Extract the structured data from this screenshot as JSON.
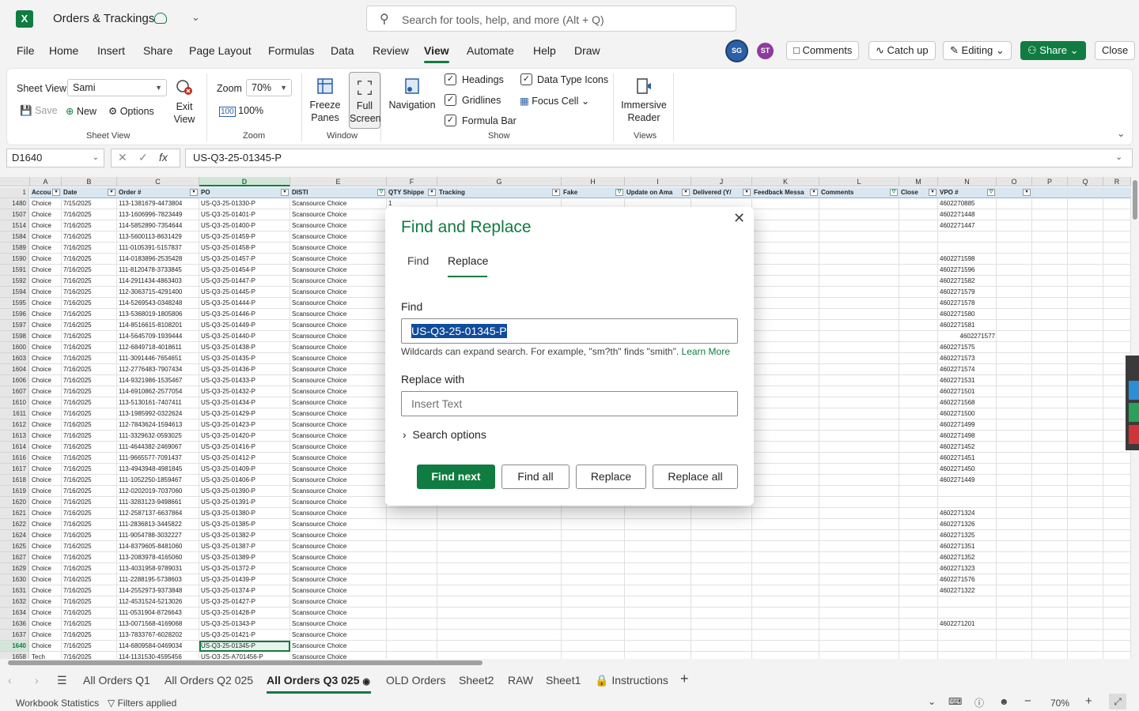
{
  "app": {
    "title": "Orders & Trackings",
    "search_placeholder": "Search for tools, help, and more (Alt + Q)",
    "logo_letter": "X"
  },
  "menu": [
    "File",
    "Home",
    "Insert",
    "Share",
    "Page Layout",
    "Formulas",
    "Data",
    "Review",
    "View",
    "Automate",
    "Help",
    "Draw"
  ],
  "active_menu": "View",
  "avatars": [
    {
      "initials": "SG",
      "color": "#2b5fa7"
    },
    {
      "initials": "ST",
      "color": "#8e3b9e"
    }
  ],
  "top_buttons": {
    "comments": "Comments",
    "catch_up": "Catch up",
    "editing": "Editing",
    "share": "Share",
    "close": "Close"
  },
  "ribbon": {
    "sheet_view_label": "Sheet View",
    "sheet_view_value": "Sami",
    "save": "Save",
    "new": "New",
    "options": "Options",
    "exit_view": "Exit View",
    "group_sheet_view": "Sheet View",
    "zoom_label": "Zoom",
    "zoom_value": "70%",
    "zoom_100": "100%",
    "group_zoom": "Zoom",
    "freeze_panes": "Freeze Panes",
    "full_screen": "Full Screen",
    "group_window": "Window",
    "navigation": "Navigation",
    "headings": "Headings",
    "gridlines": "Gridlines",
    "formula_bar": "Formula Bar",
    "data_type_icons": "Data Type Icons",
    "focus_cell": "Focus Cell",
    "group_show": "Show",
    "immersive_reader": "Immersive Reader",
    "group_views": "Views"
  },
  "formula_bar": {
    "name_box": "D1640",
    "formula": "US-Q3-25-01345-P"
  },
  "columns": [
    "A",
    "B",
    "C",
    "D",
    "E",
    "F",
    "G",
    "H",
    "I",
    "J",
    "K",
    "L",
    "M",
    "N",
    "O",
    "P",
    "Q",
    "R"
  ],
  "header_row": {
    "row_num": "1",
    "cells": [
      "Accou",
      "Date",
      "Order #",
      "PO",
      "DISTI",
      "QTY Shippe",
      "Tracking",
      "Fake",
      "Update on Ama",
      "Delivered (Y/",
      "Feedback Messa",
      "Comments",
      "Close",
      "VPO #",
      "",
      "",
      "",
      ""
    ]
  },
  "rows": [
    {
      "n": "1480",
      "a": "Choice",
      "b": "7/15/2025",
      "c": "113-1381679-4473804",
      "d": "US-Q3-25-01330-P",
      "e": "Scansource Choice",
      "f": "1",
      "vpo": "4602270885"
    },
    {
      "n": "1507",
      "a": "Choice",
      "b": "7/16/2025",
      "c": "113-1606996-7823449",
      "d": "US-Q3-25-01401-P",
      "e": "Scansource Choice",
      "f": "",
      "vpo": "4602271448"
    },
    {
      "n": "1514",
      "a": "Choice",
      "b": "7/16/2025",
      "c": "114-5852890-7354644",
      "d": "US-Q3-25-01400-P",
      "e": "Scansource Choice",
      "f": "",
      "vpo": "4602271447"
    },
    {
      "n": "1584",
      "a": "Choice",
      "b": "7/16/2025",
      "c": "113-5600113-8631429",
      "d": "US-Q3-25-01459-P",
      "e": "Scansource Choice",
      "f": "",
      "vpo": ""
    },
    {
      "n": "1589",
      "a": "Choice",
      "b": "7/16/2025",
      "c": "111-0105391-5157837",
      "d": "US-Q3-25-01458-P",
      "e": "Scansource Choice",
      "f": "",
      "vpo": ""
    },
    {
      "n": "1590",
      "a": "Choice",
      "b": "7/16/2025",
      "c": "114-0183896-2535428",
      "d": "US-Q3-25-01457-P",
      "e": "Scansource Choice",
      "f": "",
      "vpo": "4602271598"
    },
    {
      "n": "1591",
      "a": "Choice",
      "b": "7/16/2025",
      "c": "111-8120478-3733845",
      "d": "US-Q3-25-01454-P",
      "e": "Scansource Choice",
      "f": "",
      "vpo": "4602271596"
    },
    {
      "n": "1592",
      "a": "Choice",
      "b": "7/16/2025",
      "c": "114-2911434-4863403",
      "d": "US-Q3-25-01447-P",
      "e": "Scansource Choice",
      "f": "",
      "vpo": "4602271582"
    },
    {
      "n": "1594",
      "a": "Choice",
      "b": "7/16/2025",
      "c": "112-3063715-4291400",
      "d": "US-Q3-25-01445-P",
      "e": "Scansource Choice",
      "f": "",
      "vpo": "4602271579"
    },
    {
      "n": "1595",
      "a": "Choice",
      "b": "7/16/2025",
      "c": "114-5269543-0348248",
      "d": "US-Q3-25-01444-P",
      "e": "Scansource Choice",
      "f": "",
      "vpo": "4602271578"
    },
    {
      "n": "1596",
      "a": "Choice",
      "b": "7/16/2025",
      "c": "113-5368019-1805806",
      "d": "US-Q3-25-01446-P",
      "e": "Scansource Choice",
      "f": "",
      "vpo": "4602271580"
    },
    {
      "n": "1597",
      "a": "Choice",
      "b": "7/16/2025",
      "c": "114-8516615-8108201",
      "d": "US-Q3-25-01449-P",
      "e": "Scansource Choice",
      "f": "",
      "vpo": "4602271581"
    },
    {
      "n": "1598",
      "a": "Choice",
      "b": "7/16/2025",
      "c": "114-5645709-1939444",
      "d": "US-Q3-25-01440-P",
      "e": "Scansource Choice",
      "f": "",
      "vpo": "4602271577",
      "vpo_right": true
    },
    {
      "n": "1600",
      "a": "Choice",
      "b": "7/16/2025",
      "c": "112-6849718-4018611",
      "d": "US-Q3-25-01438-P",
      "e": "Scansource Choice",
      "f": "",
      "vpo": "4602271575"
    },
    {
      "n": "1603",
      "a": "Choice",
      "b": "7/16/2025",
      "c": "111-3091446-7654651",
      "d": "US-Q3-25-01435-P",
      "e": "Scansource Choice",
      "f": "",
      "vpo": "4602271573"
    },
    {
      "n": "1604",
      "a": "Choice",
      "b": "7/16/2025",
      "c": "112-2776483-7907434",
      "d": "US-Q3-25-01436-P",
      "e": "Scansource Choice",
      "f": "",
      "vpo": "4602271574"
    },
    {
      "n": "1606",
      "a": "Choice",
      "b": "7/16/2025",
      "c": "114-9321986-1535467",
      "d": "US-Q3-25-01433-P",
      "e": "Scansource Choice",
      "f": "",
      "vpo": "4602271531"
    },
    {
      "n": "1607",
      "a": "Choice",
      "b": "7/16/2025",
      "c": "114-6910862-2577054",
      "d": "US-Q3-25-01432-P",
      "e": "Scansource Choice",
      "f": "",
      "vpo": "4602271501"
    },
    {
      "n": "1610",
      "a": "Choice",
      "b": "7/16/2025",
      "c": "113-5130161-7407411",
      "d": "US-Q3-25-01434-P",
      "e": "Scansource Choice",
      "f": "",
      "vpo": "4602271568"
    },
    {
      "n": "1611",
      "a": "Choice",
      "b": "7/16/2025",
      "c": "113-1985992-0322624",
      "d": "US-Q3-25-01429-P",
      "e": "Scansource Choice",
      "f": "",
      "vpo": "4602271500"
    },
    {
      "n": "1612",
      "a": "Choice",
      "b": "7/16/2025",
      "c": "112-7843624-1594613",
      "d": "US-Q3-25-01423-P",
      "e": "Scansource Choice",
      "f": "",
      "vpo": "4602271499"
    },
    {
      "n": "1613",
      "a": "Choice",
      "b": "7/16/2025",
      "c": "111-3329632-0593025",
      "d": "US-Q3-25-01420-P",
      "e": "Scansource Choice",
      "f": "",
      "vpo": "4602271498"
    },
    {
      "n": "1614",
      "a": "Choice",
      "b": "7/16/2025",
      "c": "111-4644382-2469067",
      "d": "US-Q3-25-01416-P",
      "e": "Scansource Choice",
      "f": "",
      "vpo": "4602271452"
    },
    {
      "n": "1616",
      "a": "Choice",
      "b": "7/16/2025",
      "c": "111-9665577-7091437",
      "d": "US-Q3-25-01412-P",
      "e": "Scansource Choice",
      "f": "",
      "vpo": "4602271451"
    },
    {
      "n": "1617",
      "a": "Choice",
      "b": "7/16/2025",
      "c": "113-4943948-4981845",
      "d": "US-Q3-25-01409-P",
      "e": "Scansource Choice",
      "f": "",
      "vpo": "4602271450"
    },
    {
      "n": "1618",
      "a": "Choice",
      "b": "7/16/2025",
      "c": "111-1052250-1859467",
      "d": "US-Q3-25-01406-P",
      "e": "Scansource Choice",
      "f": "",
      "vpo": "4602271449"
    },
    {
      "n": "1619",
      "a": "Choice",
      "b": "7/16/2025",
      "c": "112-0202019-7037060",
      "d": "US-Q3-25-01390-P",
      "e": "Scansource Choice",
      "f": "",
      "vpo": ""
    },
    {
      "n": "1620",
      "a": "Choice",
      "b": "7/16/2025",
      "c": "111-3283123-9498661",
      "d": "US-Q3-25-01391-P",
      "e": "Scansource Choice",
      "f": "",
      "vpo": ""
    },
    {
      "n": "1621",
      "a": "Choice",
      "b": "7/16/2025",
      "c": "112-2587137-6637864",
      "d": "US-Q3-25-01380-P",
      "e": "Scansource Choice",
      "f": "",
      "vpo": "4602271324"
    },
    {
      "n": "1622",
      "a": "Choice",
      "b": "7/16/2025",
      "c": "111-2836813-3445822",
      "d": "US-Q3-25-01385-P",
      "e": "Scansource Choice",
      "f": "",
      "vpo": "4602271326"
    },
    {
      "n": "1624",
      "a": "Choice",
      "b": "7/16/2025",
      "c": "111-9054788-3032227",
      "d": "US-Q3-25-01382-P",
      "e": "Scansource Choice",
      "f": "",
      "vpo": "4602271325"
    },
    {
      "n": "1625",
      "a": "Choice",
      "b": "7/16/2025",
      "c": "114-8379605-8481060",
      "d": "US-Q3-25-01387-P",
      "e": "Scansource Choice",
      "f": "",
      "vpo": "4602271351"
    },
    {
      "n": "1627",
      "a": "Choice",
      "b": "7/16/2025",
      "c": "113-2083978-4165060",
      "d": "US-Q3-25-01389-P",
      "e": "Scansource Choice",
      "f": "",
      "vpo": "4602271352"
    },
    {
      "n": "1629",
      "a": "Choice",
      "b": "7/16/2025",
      "c": "113-4031958-9789031",
      "d": "US-Q3-25-01372-P",
      "e": "Scansource Choice",
      "f": "",
      "vpo": "4602271323"
    },
    {
      "n": "1630",
      "a": "Choice",
      "b": "7/16/2025",
      "c": "111-2288195-5738603",
      "d": "US-Q3-25-01439-P",
      "e": "Scansource Choice",
      "f": "",
      "vpo": "4602271576"
    },
    {
      "n": "1631",
      "a": "Choice",
      "b": "7/16/2025",
      "c": "114-2552973-9373848",
      "d": "US-Q3-25-01374-P",
      "e": "Scansource Choice",
      "f": "",
      "vpo": "4602271322"
    },
    {
      "n": "1632",
      "a": "Choice",
      "b": "7/16/2025",
      "c": "112-4531524-5213026",
      "d": "US-Q3-25-01427-P",
      "e": "Scansource Choice",
      "f": "",
      "vpo": ""
    },
    {
      "n": "1634",
      "a": "Choice",
      "b": "7/16/2025",
      "c": "111-0531904-8726643",
      "d": "US-Q3-25-01428-P",
      "e": "Scansource Choice",
      "f": "",
      "vpo": ""
    },
    {
      "n": "1636",
      "a": "Choice",
      "b": "7/16/2025",
      "c": "113-0071568-4169068",
      "d": "US-Q3-25-01343-P",
      "e": "Scansource Choice",
      "f": "",
      "vpo": "4602271201"
    },
    {
      "n": "1637",
      "a": "Choice",
      "b": "7/16/2025",
      "c": "113-7833767-6028202",
      "d": "US-Q3-25-01421-P",
      "e": "Scansource Choice",
      "f": "",
      "vpo": ""
    },
    {
      "n": "1640",
      "a": "Choice",
      "b": "7/16/2025",
      "c": "114-6809584-0469034",
      "d": "US-Q3-25-01345-P",
      "e": "Scansource Choice",
      "f": "",
      "vpo": "",
      "active": true
    },
    {
      "n": "1658",
      "a": "Tech",
      "b": "7/16/2025",
      "c": "114-1131530-4595456",
      "d": "US-Q3-25-A701456-P",
      "e": "Scansource Choice",
      "f": "",
      "vpo": ""
    }
  ],
  "sheet_tabs": [
    "All Orders Q1",
    "All Orders Q2 025",
    "All Orders Q3 025",
    "OLD Orders",
    "Sheet2",
    "RAW",
    "Sheet1",
    "Instructions"
  ],
  "active_sheet": "All Orders Q3 025",
  "status": {
    "workbook_statistics": "Workbook Statistics",
    "filters_applied": "Filters applied",
    "zoom": "70%"
  },
  "dialog": {
    "title": "Find and Replace",
    "tab_find": "Find",
    "tab_replace": "Replace",
    "find_label": "Find",
    "find_value": "US-Q3-25-01345-P",
    "hint": "Wildcards can expand search. For example, \"sm?th\" finds \"smith\".",
    "learn_more": "Learn More",
    "replace_label": "Replace with",
    "replace_placeholder": "Insert Text",
    "search_options": "Search options",
    "find_next": "Find next",
    "find_all": "Find all",
    "replace": "Replace",
    "replace_all": "Replace all"
  },
  "colors": {
    "accent": "#107c41",
    "selection_blue": "#0f4c9c",
    "header_fill": "#d9e7f2"
  }
}
